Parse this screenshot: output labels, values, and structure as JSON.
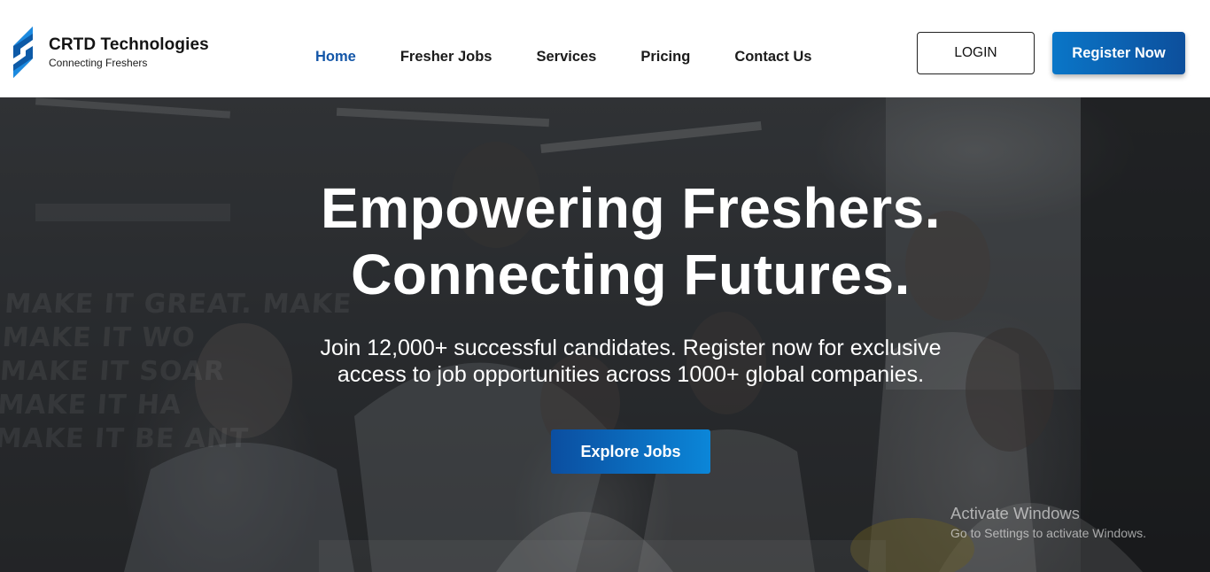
{
  "brand": {
    "name": "CRTD Technologies",
    "tagline": "Connecting Freshers",
    "logo_icon": "crtd-s-logo-icon"
  },
  "nav": {
    "items": [
      {
        "label": "Home",
        "active": true
      },
      {
        "label": "Fresher Jobs",
        "active": false
      },
      {
        "label": "Services",
        "active": false
      },
      {
        "label": "Pricing",
        "active": false
      },
      {
        "label": "Contact Us",
        "active": false
      }
    ]
  },
  "actions": {
    "login_label": "LOGIN",
    "register_label": "Register Now"
  },
  "hero": {
    "title_line1": "Empowering Freshers.",
    "title_line2": "Connecting Futures.",
    "subtitle_line1": "Join 12,000+ successful candidates. Register now for exclusive",
    "subtitle_line2": "access to job opportunities across 1000+ global companies.",
    "cta_label": "Explore Jobs",
    "wall_text": [
      "MAKE IT GREAT. MAKE",
      "MAKE IT WO",
      "MAKE IT SOAR",
      "MAKE IT HA",
      "MAKE IT BE    ANT"
    ]
  },
  "watermark": {
    "title": "Activate Windows",
    "subtitle": "Go to Settings to activate Windows."
  },
  "colors": {
    "brand_blue": "#1356a8",
    "register_gradient_start": "#0a76c8",
    "register_gradient_end": "#0d4f9c",
    "cta_gradient_start": "#0b4ea0",
    "cta_gradient_end": "#0b86d8"
  }
}
